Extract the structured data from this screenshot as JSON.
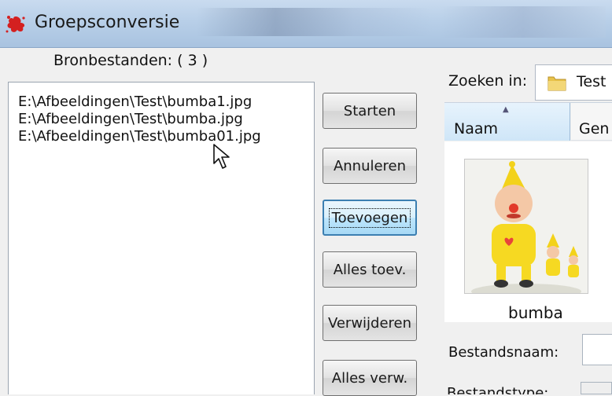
{
  "window": {
    "title": "Groepsconversie",
    "icon": "splash-app-icon"
  },
  "source": {
    "label": "Bronbestanden:  ( 3 )",
    "files": [
      "E:\\Afbeeldingen\\Test\\bumba1.jpg",
      "E:\\Afbeeldingen\\Test\\bumba.jpg",
      "E:\\Afbeeldingen\\Test\\bumba01.jpg"
    ]
  },
  "buttons": {
    "start": "Starten",
    "cancel": "Annuleren",
    "add": "Toevoegen",
    "add_all": "Alles toev.",
    "remove": "Verwijderen",
    "remove_all": "Alles verw."
  },
  "browser": {
    "search_label": "Zoeken in:",
    "search_folder": "Test",
    "columns": [
      "Naam",
      "Gen"
    ],
    "sorted_column": "Naam",
    "thumbnail_caption": "bumba",
    "filename_label": "Bestandsnaam:",
    "filename_value": "",
    "filetype_label": "Bestandstype:"
  },
  "colors": {
    "titlebar": "#b8cfe8",
    "focus_border": "#3c7fb1",
    "header_highlight": "#cfe6f8",
    "icon_red": "#d42020",
    "folder_yellow": "#e8c24a"
  }
}
